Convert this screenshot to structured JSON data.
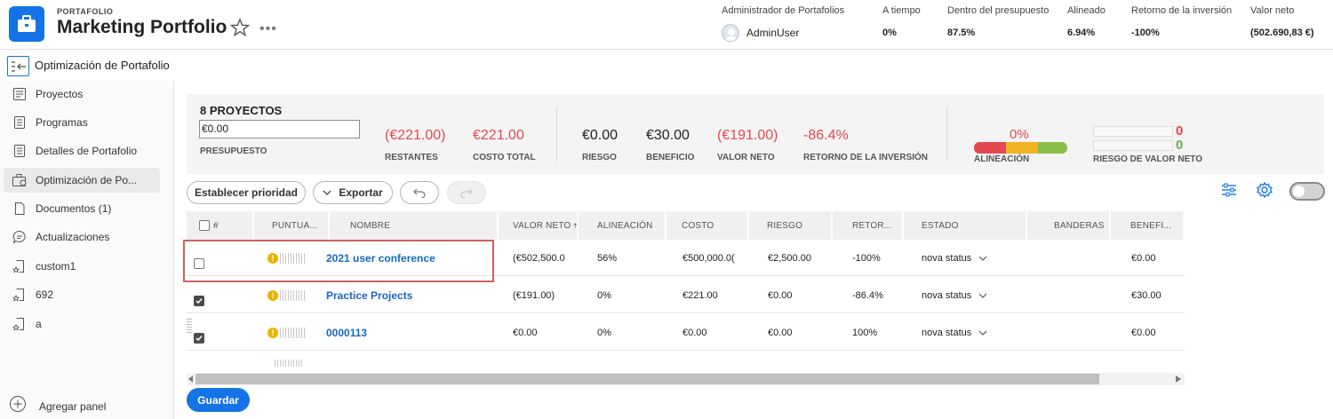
{
  "header": {
    "kicker": "PORTAFOLIO",
    "title": "Marketing Portfolio",
    "more": "•••",
    "owner_label": "Administrador de Portafolios",
    "owner_name": "AdminUser",
    "metrics": [
      {
        "label": "A tiempo",
        "value": "0%"
      },
      {
        "label": "Dentro del presupuesto",
        "value": "87.5%"
      },
      {
        "label": "Alineado",
        "value": "6.94%"
      },
      {
        "label": "Retorno de la inversión",
        "value": "-100%"
      },
      {
        "label": "Valor neto",
        "value": "(502.690,83 €)"
      }
    ]
  },
  "subbar": {
    "title": "Optimización de Portafolio"
  },
  "sidebar": {
    "items": [
      {
        "label": "Proyectos",
        "icon": "projects-icon"
      },
      {
        "label": "Programas",
        "icon": "programs-icon"
      },
      {
        "label": "Detalles de Portafolio",
        "icon": "details-icon"
      },
      {
        "label": "Optimización de Po...",
        "icon": "optimization-icon"
      },
      {
        "label": "Documentos (1)",
        "icon": "document-icon"
      },
      {
        "label": "Actualizaciones",
        "icon": "chat-icon"
      },
      {
        "label": "custom1",
        "icon": "custom-page-icon"
      },
      {
        "label": "692",
        "icon": "custom-page-icon"
      },
      {
        "label": "a",
        "icon": "custom-page-icon"
      }
    ],
    "add_panel": "Agregar panel"
  },
  "summary": {
    "title": "8 PROYECTOS",
    "budget_value": "€0.00",
    "budget_label": "PRESUPUESTO",
    "remaining_value": "(€221.00)",
    "remaining_label": "RESTANTES",
    "total_cost_value": "€221.00",
    "total_cost_label": "COSTO TOTAL",
    "risk_value": "€0.00",
    "risk_label": "RIESGO",
    "benefit_value": "€30.00",
    "benefit_label": "BENEFICIO",
    "net_value_value": "(€191.00)",
    "net_value_label": "VALOR NETO",
    "roi_value": "-86.4%",
    "roi_label": "RETORNO DE LA INVERSIÓN",
    "alignment_value": "0%",
    "alignment_label": "ALINEACIÓN",
    "net_risk_top": "0",
    "net_risk_bottom": "0",
    "net_risk_label": "RIESGO DE VALOR NETO",
    "colors": {
      "negative": "#e34850",
      "positive": "#2d9d78"
    }
  },
  "toolbar": {
    "prioritize": "Establecer prioridad",
    "export": "Exportar"
  },
  "table": {
    "headers": [
      "#",
      "PUNTUA...",
      "NOMBRE",
      "VALOR NETO",
      "ALINEACIÓN",
      "COSTO",
      "RIESGO",
      "RETOR...",
      "ESTADO",
      "BANDERAS",
      "BENEFI..."
    ],
    "rows": [
      {
        "checked": false,
        "name": "2021 user conference",
        "net_value": "(€502,500.0",
        "alignment": "56%",
        "cost": "€500,000.0(",
        "risk": "€2,500.00",
        "roi": "-100%",
        "status": "nova status",
        "flags": "",
        "benefit": "€0.00"
      },
      {
        "checked": true,
        "name": "Practice Projects",
        "net_value": "(€191.00)",
        "alignment": "0%",
        "cost": "€221.00",
        "risk": "€0.00",
        "roi": "-86.4%",
        "status": "nova status",
        "flags": "",
        "benefit": "€30.00"
      },
      {
        "checked": true,
        "name": "0000113",
        "net_value": "€0.00",
        "alignment": "0%",
        "cost": "€0.00",
        "risk": "€0.00",
        "roi": "100%",
        "status": "nova status",
        "flags": "",
        "benefit": "€0.00"
      }
    ]
  },
  "footer": {
    "save": "Guardar"
  }
}
